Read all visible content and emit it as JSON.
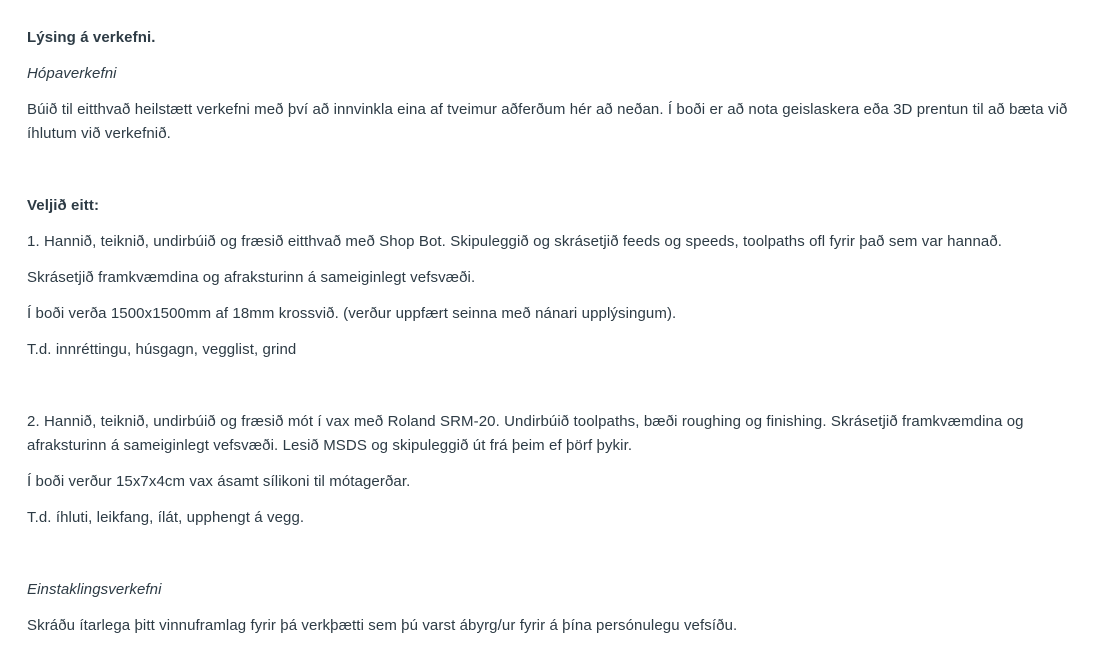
{
  "description_heading": "Lýsing á verkefni.",
  "group_project": {
    "label": "Hópaverkefni",
    "intro": "Búið til eitthvað heilstætt verkefni með því að innvinkla eina af tveimur aðferðum hér að neðan. Í boði er að nota geislaskera eða 3D prentun til að bæta við íhlutum við verkefnið."
  },
  "choose_heading": "Veljið eitt:",
  "option1": {
    "text": "1. Hannið, teiknið, undirbúið og fræsið eitthvað með Shop Bot. Skipuleggið og skrásetjið feeds og speeds, toolpaths ofl fyrir það sem var hannað.",
    "document": "Skrásetjið framkvæmdina og afraksturinn á sameiginlegt vefsvæði.",
    "materials": "Í boði verða 1500x1500mm af 18mm krossvið. (verður uppfært seinna með nánari upplýsingum).",
    "examples": "T.d. innréttingu, húsgagn, vegglist, grind"
  },
  "option2": {
    "text": "2. Hannið, teiknið, undirbúið og fræsið mót í vax með Roland SRM-20. Undirbúið toolpaths, bæði roughing og finishing. Skrásetjið framkvæmdina og afraksturinn á sameiginlegt vefsvæði. Lesið MSDS og skipuleggið út frá þeim ef þörf þykir.",
    "materials": "Í boði verður 15x7x4cm vax ásamt sílikoni til mótagerðar.",
    "examples": "T.d. íhluti, leikfang, ílát, upphengt á vegg."
  },
  "individual_project": {
    "label": "Einstaklingsverkefni",
    "text": "Skráðu ítarlega þitt vinnuframlag fyrir þá verkþætti sem þú varst ábyrg/ur fyrir á þína persónulegu vefsíðu."
  }
}
